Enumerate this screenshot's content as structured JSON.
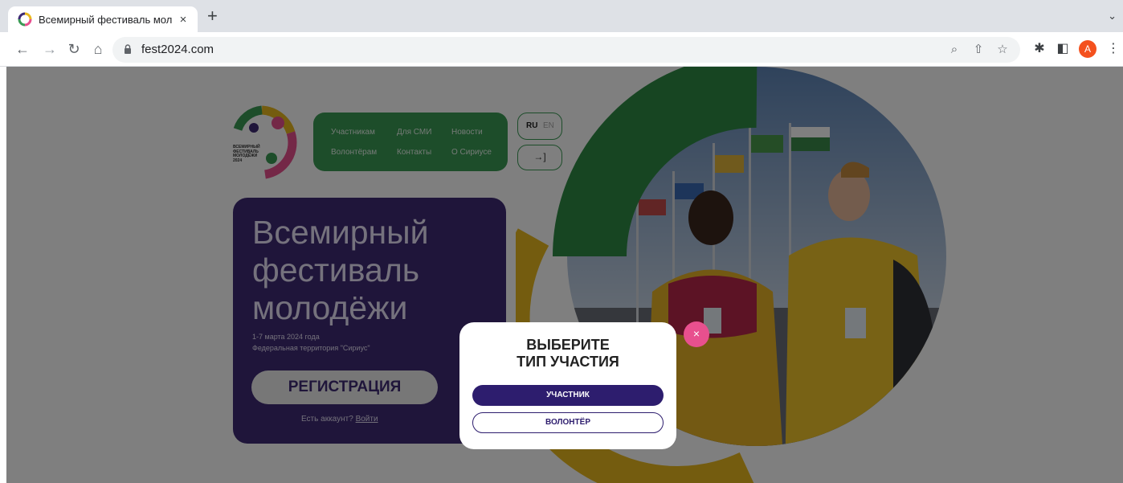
{
  "browser": {
    "tab_title": "Всемирный фестиваль молод",
    "tab_close": "×",
    "new_tab": "+",
    "tab_menu": "⌄",
    "url": "fest2024.com",
    "avatar_letter": "A",
    "icons": [
      "back-icon",
      "forward-icon",
      "reload-icon",
      "home-icon",
      "lock-icon",
      "zoom-icon",
      "share-icon",
      "bookmark-star-icon",
      "extensions-icon",
      "side-panel-icon",
      "kebab-menu-icon"
    ]
  },
  "site": {
    "logo_text": "ВСЕМИРНЫЙ ФЕСТИВАЛЬ МОЛОДЁЖИ 2024",
    "nav": [
      "Участникам",
      "Для СМИ",
      "Новости",
      "Волонтёрам",
      "Контакты",
      "О Сириусе"
    ],
    "lang_ru": "RU",
    "lang_en": "EN",
    "login_icon": "→]",
    "hero_title": "Всемирный фестиваль молодёжи",
    "hero_date": "1-7 марта 2024 года\nФедеральная территория \"Сириус\"",
    "register_label": "РЕГИСТРАЦИЯ",
    "account_text": "Есть аккаунт?",
    "login_link": "Войти"
  },
  "modal": {
    "title": "ВЫБЕРИТЕ\nТИП УЧАСТИЯ",
    "participant_label": "УЧАСТНИК",
    "volunteer_label": "ВОЛОНТЁР",
    "close_label": "×"
  },
  "colors": {
    "green": "#3a9a55",
    "purple": "#3e2a75",
    "yellow": "#e9b91f",
    "pink": "#e8508e",
    "modal_button": "#2d1d6e"
  }
}
